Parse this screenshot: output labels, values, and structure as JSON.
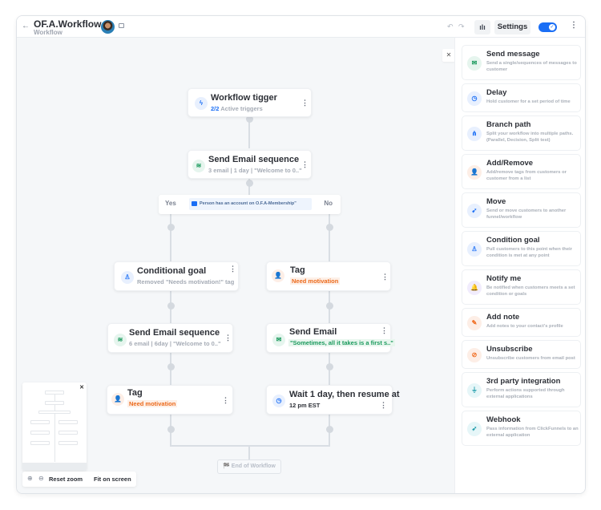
{
  "header": {
    "back_icon": "arrow-left-icon",
    "title": "OF.A.Workflow",
    "subtitle": "Workflow",
    "undo_icon": "↶",
    "redo_icon": "↷",
    "analytics_icon": "ılı",
    "settings_label": "Settings",
    "toggle_on": true,
    "toggle_check": "✓",
    "more_icon": "⋮"
  },
  "workflow": {
    "trigger": {
      "title": "Workflow tigger",
      "count": "2/2",
      "subtitle": "Active triggers",
      "icon": "ϟ"
    },
    "email_seq_1": {
      "title": "Send Email sequence",
      "subtitle": "3 email | 1 day | \"Welcome to 0..\"",
      "icon": "≋"
    },
    "branch": {
      "yes": "Yes",
      "no": "No",
      "condition": "Person has an account on O.F.A-Membership\""
    },
    "conditional_goal": {
      "title": "Conditional goal",
      "subtitle": "Removed \"Needs motivation!\" tag",
      "icon": "♙"
    },
    "tag_right": {
      "title": "Tag",
      "tag": "Need motivation",
      "icon": "👤"
    },
    "email_seq_2": {
      "title": "Send Email sequence",
      "subtitle": "6 email | 6day | \"Welcome to 0..\"",
      "icon": "≋"
    },
    "send_email": {
      "title": "Send Email",
      "subtitle": "\"Sometimes, all it takes is a first s..\"",
      "icon": "✉"
    },
    "tag_left": {
      "title": "Tag",
      "tag": "Need motivation",
      "icon": "👤"
    },
    "wait": {
      "title": "Wait 1 day, then resume at",
      "subtitle": "12 pm EST",
      "icon": "◷"
    },
    "end": {
      "label": "🏁 End of Workflow"
    },
    "menu_icon": "⋮"
  },
  "zoom_bar": {
    "zoom_in_icon": "⊕",
    "zoom_out_icon": "⊖",
    "reset_label": "Reset zoom",
    "fit_label": "Fit on screen"
  },
  "minimap": {
    "close_icon": "✕"
  },
  "panel": {
    "close_icon": "✕",
    "items": [
      {
        "title": "Send message",
        "desc": "Send a single/sequences of messages to customer",
        "icon": "✉"
      },
      {
        "title": "Delay",
        "desc": "Hold customer for a set period of time",
        "icon": "◷"
      },
      {
        "title": "Branch path",
        "desc": "Split your workflow into multiple paths. (Parallel, Decision, Split test)",
        "icon": "⋔"
      },
      {
        "title": "Add/Remove",
        "desc": "Add/remove tags from customers or customer from a list",
        "icon": "👤"
      },
      {
        "title": "Move",
        "desc": "Send or move customers to another funnel/workflow",
        "icon": "➹"
      },
      {
        "title": "Condition goal",
        "desc": "Pull customers to this point when their condition is met at any point",
        "icon": "♙"
      },
      {
        "title": "Notify me",
        "desc": "Be notified when customers meets a set condition or goals",
        "icon": "🔔"
      },
      {
        "title": "Add note",
        "desc": "Add notes to your contact's profile",
        "icon": "✎"
      },
      {
        "title": "Unsubscribe",
        "desc": "Unsubscribe customers from email post",
        "icon": "⊘"
      },
      {
        "title": "3rd party integration",
        "desc": "Perform actions supported through external applications",
        "icon": "⏚"
      },
      {
        "title": "Webhook",
        "desc": "Pass information from ClickFunnels to an external application",
        "icon": "➶"
      }
    ]
  }
}
